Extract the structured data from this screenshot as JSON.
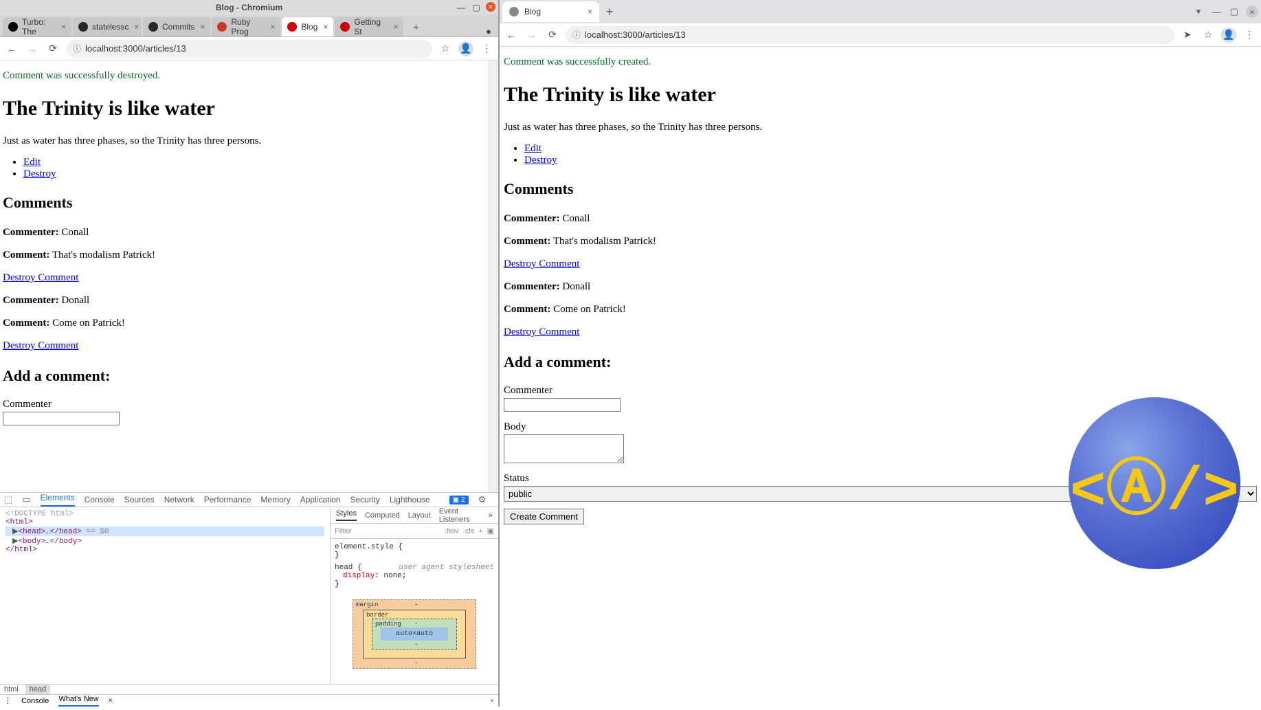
{
  "left": {
    "window_title": "Blog - Chromium",
    "tabs": [
      {
        "label": "Turbo: The"
      },
      {
        "label": "statelessc"
      },
      {
        "label": "Commits"
      },
      {
        "label": "Ruby Prog"
      },
      {
        "label": "Blog"
      },
      {
        "label": "Getting St"
      }
    ],
    "active_tab_index": 4,
    "url": "localhost:3000/articles/13",
    "flash": "Comment was successfully destroyed.",
    "article": {
      "title": "The Trinity is like water",
      "body": "Just as water has three phases, so the Trinity has three persons.",
      "edit_link": "Edit",
      "destroy_link": "Destroy"
    },
    "comments_heading": "Comments",
    "commenter_label": "Commenter:",
    "comment_label": "Comment:",
    "destroy_comment_link": "Destroy Comment",
    "comments": [
      {
        "commenter": "Conall",
        "body": "That's modalism Patrick!"
      },
      {
        "commenter": "Donall",
        "body": "Come on Patrick!"
      }
    ],
    "add_comment_heading": "Add a comment:",
    "form": {
      "commenter_label": "Commenter"
    },
    "devtools": {
      "tabs": [
        "Elements",
        "Console",
        "Sources",
        "Network",
        "Performance",
        "Memory",
        "Application",
        "Security",
        "Lighthouse"
      ],
      "active_tab": 0,
      "badge_count": "2",
      "dom_lines": {
        "doctype": "<!DOCTYPE html>",
        "html_open": "<html>",
        "head": "<head>…</head>",
        "head_equal": " == $0",
        "body": "<body>…</body>",
        "html_close": "</html>"
      },
      "styles_tabs": [
        "Styles",
        "Computed",
        "Layout",
        "Event Listeners"
      ],
      "filter_placeholder": "Filter",
      "hov": ":hov",
      "cls": ".cls",
      "element_style": "element.style {",
      "head_rule": "head {",
      "ua_label": "user agent stylesheet",
      "display_none": "display: none;",
      "box_model": {
        "margin": "margin",
        "border": "border",
        "padding": "padding",
        "content": "auto×auto",
        "dash": "-"
      },
      "breadcrumb": [
        "html",
        "head"
      ],
      "console_tabs": [
        "Console",
        "What's New"
      ]
    }
  },
  "right": {
    "tab_label": "Blog",
    "url": "localhost:3000/articles/13",
    "flash": "Comment was successfully created.",
    "article": {
      "title": "The Trinity is like water",
      "body": "Just as water has three phases, so the Trinity has three persons.",
      "edit_link": "Edit",
      "destroy_link": "Destroy"
    },
    "comments_heading": "Comments",
    "commenter_label": "Commenter:",
    "comment_label": "Comment:",
    "destroy_comment_link": "Destroy Comment",
    "comments": [
      {
        "commenter": "Conall",
        "body": "That's modalism Patrick!"
      },
      {
        "commenter": "Donall",
        "body": "Come on Patrick!"
      }
    ],
    "add_comment_heading": "Add a comment:",
    "form": {
      "commenter_label": "Commenter",
      "body_label": "Body",
      "status_label": "Status",
      "status_value": "public",
      "submit_label": "Create Comment"
    }
  }
}
